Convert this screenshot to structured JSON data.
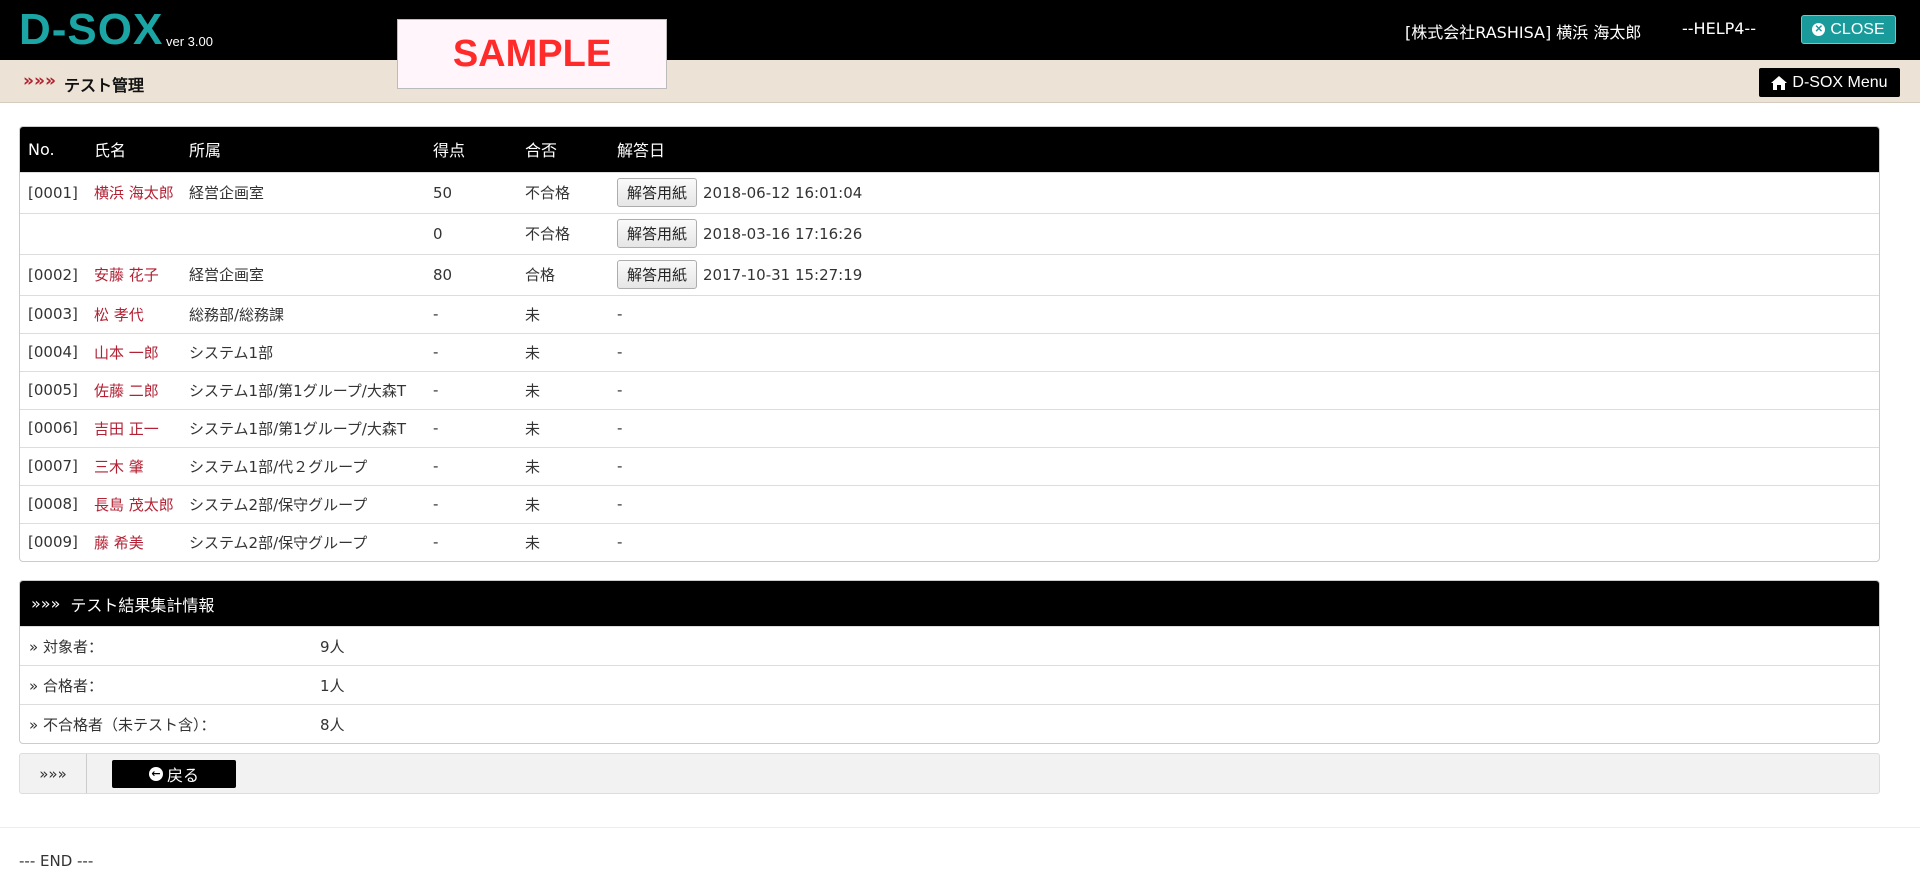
{
  "header": {
    "logo": "D-SOX",
    "version": "ver 3.00",
    "sample_label": "SAMPLE",
    "user": "[株式会社RASHISA]  横浜 海太郎",
    "help": "--HELP4--",
    "close_label": "CLOSE",
    "close_icon": "times-circle-icon"
  },
  "subheader": {
    "arrows": "»»»",
    "title": "テスト管理",
    "menu_label": "D-SOX Menu",
    "menu_icon": "home-icon"
  },
  "table": {
    "columns": [
      "No.",
      "氏名",
      "所属",
      "得点",
      "合否",
      "解答日"
    ],
    "answer_button_label": "解答用紙",
    "rows": [
      {
        "no": "[0001]",
        "name": "横浜 海太郎",
        "dept": "経営企画室",
        "score": "50",
        "result": "不合格",
        "has_sheet": true,
        "date": "2018-06-12 16:01:04"
      },
      {
        "no": "",
        "name": "",
        "dept": "",
        "score": "0",
        "result": "不合格",
        "has_sheet": true,
        "date": "2018-03-16 17:16:26"
      },
      {
        "no": "[0002]",
        "name": "安藤 花子",
        "dept": "経営企画室",
        "score": "80",
        "result": "合格",
        "has_sheet": true,
        "date": "2017-10-31 15:27:19"
      },
      {
        "no": "[0003]",
        "name": "松 孝代",
        "dept": "総務部/総務課",
        "score": "-",
        "result": "未",
        "has_sheet": false,
        "date": "-"
      },
      {
        "no": "[0004]",
        "name": "山本 一郎",
        "dept": "システム1部",
        "score": "-",
        "result": "未",
        "has_sheet": false,
        "date": "-"
      },
      {
        "no": "[0005]",
        "name": "佐藤 二郎",
        "dept": "システム1部/第1グループ/大森T",
        "score": "-",
        "result": "未",
        "has_sheet": false,
        "date": "-"
      },
      {
        "no": "[0006]",
        "name": "吉田 正一",
        "dept": "システム1部/第1グループ/大森T",
        "score": "-",
        "result": "未",
        "has_sheet": false,
        "date": "-"
      },
      {
        "no": "[0007]",
        "name": "三木 肇",
        "dept": "システム1部/代２グループ",
        "score": "-",
        "result": "未",
        "has_sheet": false,
        "date": "-"
      },
      {
        "no": "[0008]",
        "name": "長島 茂太郎",
        "dept": "システム2部/保守グループ",
        "score": "-",
        "result": "未",
        "has_sheet": false,
        "date": "-"
      },
      {
        "no": "[0009]",
        "name": "藤 希美",
        "dept": "システム2部/保守グループ",
        "score": "-",
        "result": "未",
        "has_sheet": false,
        "date": "-"
      }
    ]
  },
  "stats": {
    "arrows": "»»»",
    "title": "テスト結果集計情報",
    "rows": [
      {
        "label": "» 対象者：",
        "value": "9人"
      },
      {
        "label": "» 合格者：",
        "value": "1人"
      },
      {
        "label": "» 不合格者（未テスト含）：",
        "value": "8人"
      }
    ]
  },
  "nav": {
    "arrows": "»»»",
    "back_label": "戻る",
    "back_icon": "arrow-circle-left-icon"
  },
  "footer": {
    "end_text": "--- END ---"
  },
  "colors": {
    "brand": "#1ba5a5",
    "name_link": "#b22234",
    "header_bg": "#000000",
    "subbar_bg": "#ece2d5"
  }
}
